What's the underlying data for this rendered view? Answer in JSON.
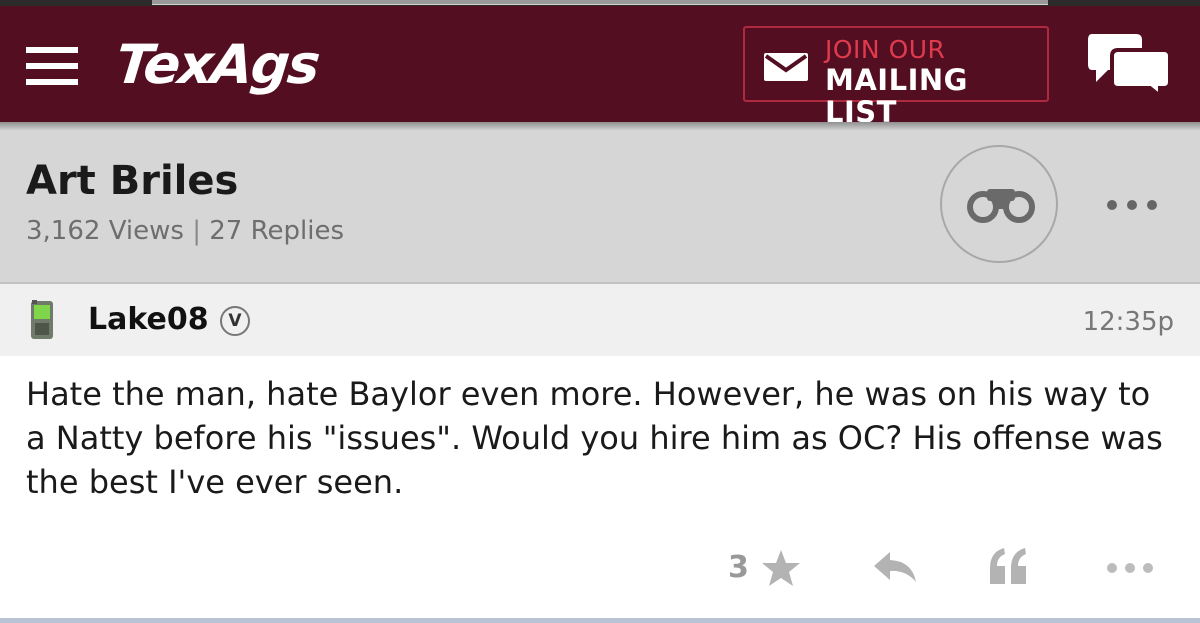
{
  "header": {
    "logo_text": "TexAgs",
    "mailing": {
      "line1": "JOIN OUR",
      "line2": "MAILING LIST"
    },
    "menu_icon": "hamburger-menu-icon",
    "chat_icon": "chat-bubbles-icon",
    "colors": {
      "bar": "#540e22",
      "accent": "#e03a4e"
    }
  },
  "thread": {
    "title": "Art Briles",
    "views": "3,162 Views",
    "separator": "|",
    "replies": "27 Replies",
    "watch_icon": "binoculars-icon",
    "more_icon": "ellipsis-icon"
  },
  "post": {
    "username": "Lake08",
    "badge": "V",
    "time": "12:35p",
    "device_icon": "phone-icon",
    "body": "Hate the man, hate Baylor even more. However, he was on his way to a Natty before his \"issues\". Would you hire him as OC? His offense was the best I've ever seen.",
    "rating": "3",
    "action_icons": [
      "star-icon",
      "reply-icon",
      "quote-icon",
      "ellipsis-icon"
    ]
  }
}
